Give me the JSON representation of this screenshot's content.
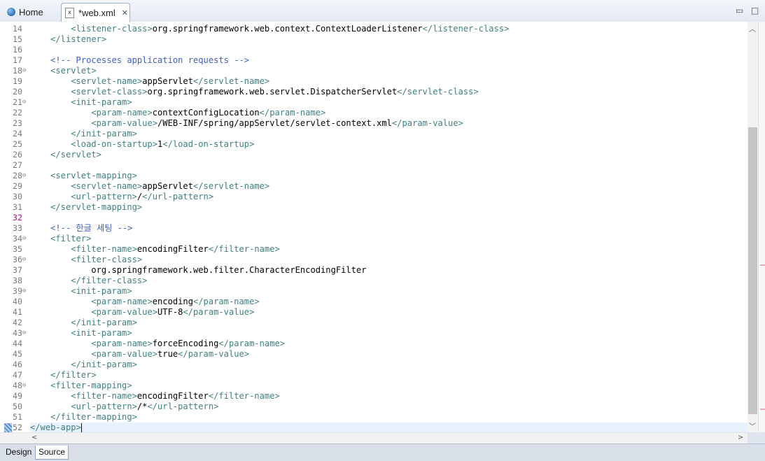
{
  "tabs": {
    "home": {
      "label": "Home",
      "icon": "globe-icon"
    },
    "web_xml": {
      "label": "*web.xml",
      "icon": "xml-file-icon",
      "close": "✕"
    }
  },
  "window_controls": {
    "minimize": "▭",
    "maximize": "□"
  },
  "editor": {
    "lines": [
      {
        "n": "14",
        "code": "        <listener-class>org.springframework.web.context.ContextLoaderListener</listener-class>"
      },
      {
        "n": "15",
        "code": "    </listener>"
      },
      {
        "n": "16",
        "code": ""
      },
      {
        "n": "17",
        "code": "    <!-- Processes application requests -->"
      },
      {
        "n": "18",
        "code": "    <servlet>",
        "fold": true
      },
      {
        "n": "19",
        "code": "        <servlet-name>appServlet</servlet-name>"
      },
      {
        "n": "20",
        "code": "        <servlet-class>org.springframework.web.servlet.DispatcherServlet</servlet-class>"
      },
      {
        "n": "21",
        "code": "        <init-param>",
        "fold": true
      },
      {
        "n": "22",
        "code": "            <param-name>contextConfigLocation</param-name>"
      },
      {
        "n": "23",
        "code": "            <param-value>/WEB-INF/spring/appServlet/servlet-context.xml</param-value>"
      },
      {
        "n": "24",
        "code": "        </init-param>"
      },
      {
        "n": "25",
        "code": "        <load-on-startup>1</load-on-startup>"
      },
      {
        "n": "26",
        "code": "    </servlet>"
      },
      {
        "n": "27",
        "code": ""
      },
      {
        "n": "28",
        "code": "    <servlet-mapping>",
        "fold": true
      },
      {
        "n": "29",
        "code": "        <servlet-name>appServlet</servlet-name>"
      },
      {
        "n": "30",
        "code": "        <url-pattern>/</url-pattern>"
      },
      {
        "n": "31",
        "code": "    </servlet-mapping>"
      },
      {
        "n": "32",
        "code": "",
        "highlight": true
      },
      {
        "n": "33",
        "code": "    <!-- 한글 세팅 -->"
      },
      {
        "n": "34",
        "code": "    <filter>",
        "fold": true
      },
      {
        "n": "35",
        "code": "        <filter-name>encodingFilter</filter-name>"
      },
      {
        "n": "36",
        "code": "        <filter-class>",
        "fold": true
      },
      {
        "n": "37",
        "code": "            org.springframework.web.filter.CharacterEncodingFilter"
      },
      {
        "n": "38",
        "code": "        </filter-class>"
      },
      {
        "n": "39",
        "code": "        <init-param>",
        "fold": true
      },
      {
        "n": "40",
        "code": "            <param-name>encoding</param-name>"
      },
      {
        "n": "41",
        "code": "            <param-value>UTF-8</param-value>"
      },
      {
        "n": "42",
        "code": "        </init-param>"
      },
      {
        "n": "43",
        "code": "        <init-param>",
        "fold": true
      },
      {
        "n": "44",
        "code": "            <param-name>forceEncoding</param-name>"
      },
      {
        "n": "45",
        "code": "            <param-value>true</param-value>"
      },
      {
        "n": "46",
        "code": "        </init-param>"
      },
      {
        "n": "47",
        "code": "    </filter>"
      },
      {
        "n": "48",
        "code": "    <filter-mapping>",
        "fold": true
      },
      {
        "n": "49",
        "code": "        <filter-name>encodingFilter</filter-name>"
      },
      {
        "n": "50",
        "code": "        <url-pattern>/*</url-pattern>"
      },
      {
        "n": "51",
        "code": "    </filter-mapping>"
      },
      {
        "n": "52",
        "code": "</web-app>",
        "current": true
      }
    ],
    "fold_glyph": "⊖"
  },
  "scrollbar": {
    "up": "︿",
    "down": "﹀",
    "left": "<",
    "right": ">"
  },
  "bottom_tabs": {
    "design": "Design",
    "source": "Source",
    "active": "Source"
  },
  "colors": {
    "tag": "#3f7f7f",
    "text": "#000000",
    "comment": "#3f5fbf",
    "line_number": "#787878",
    "current_line": "#e8f2fe"
  }
}
